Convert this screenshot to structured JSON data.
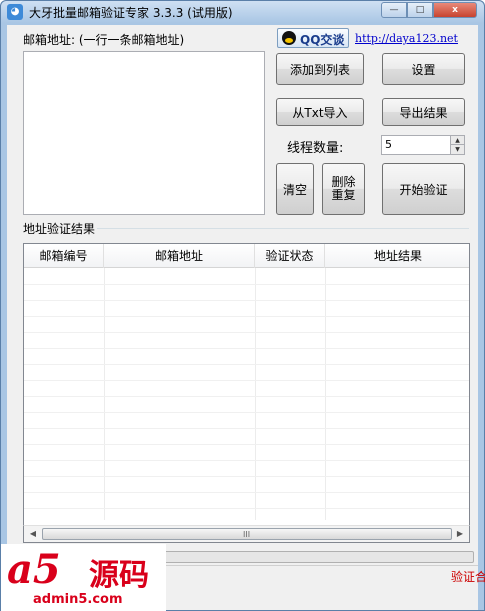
{
  "window": {
    "title": "大牙批量邮箱验证专家 3.3.3 (试用版)",
    "min_glyph": "—",
    "max_glyph": "□",
    "close_glyph": "x"
  },
  "form": {
    "email_label": "邮箱地址: (一行一条邮箱地址)",
    "qq_label": "QQ交谈",
    "link": "http://daya123.net",
    "threads_label": "线程数量:",
    "threads_value": "5"
  },
  "buttons": {
    "add_to_list": "添加到列表",
    "settings": "设置",
    "import_txt": "从Txt导入",
    "export": "导出结果",
    "clear": "清空",
    "dedupe_line1": "删除",
    "dedupe_line2": "重复",
    "start": "开始验证"
  },
  "results": {
    "group_label": "地址验证结果",
    "columns": [
      "邮箱编号",
      "邮箱地址",
      "验证状态",
      "地址结果"
    ],
    "rows": []
  },
  "scrollbar": {
    "left_glyph": "◀",
    "right_glyph": "▶",
    "grip": "III"
  },
  "status": {
    "text": "验证合"
  },
  "watermark": {
    "logo_a5": "a5",
    "logo_cn": "源码",
    "url": "admin5.com"
  },
  "colors": {
    "status_red": "#cc0000",
    "link_blue": "#0000cc",
    "watermark_red": "#d9001b"
  }
}
